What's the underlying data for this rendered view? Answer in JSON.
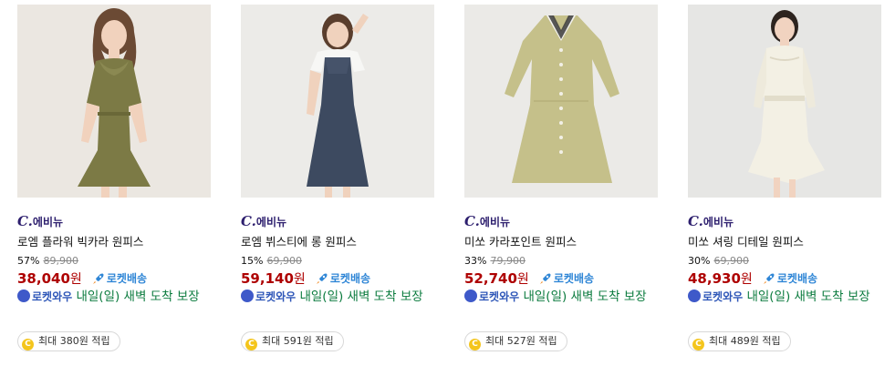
{
  "products": [
    {
      "brand_mark": "C.",
      "brand": "에비뉴",
      "name": "로엠 플라워 빅카라 원피스",
      "discount": "57%",
      "original_price": "89,900",
      "price": "38,040",
      "won": "원",
      "rocket_label": "로켓배송",
      "wow_label": "로켓와우",
      "delivery": "내일(일) 새벽 도착 보장",
      "reward": "최대 380원 적립",
      "coin_symbol": "C",
      "image_desc": "dress-floral-olive"
    },
    {
      "brand_mark": "C.",
      "brand": "에비뉴",
      "name": "로엠 뷔스티에 롱 원피스",
      "discount": "15%",
      "original_price": "69,900",
      "price": "59,140",
      "won": "원",
      "rocket_label": "로켓배송",
      "wow_label": "로켓와우",
      "delivery": "내일(일) 새벽 도착 보장",
      "reward": "최대 591원 적립",
      "coin_symbol": "C",
      "image_desc": "dress-navy-bustier"
    },
    {
      "brand_mark": "C.",
      "brand": "에비뉴",
      "name": "미쏘 카라포인트 원피스",
      "discount": "33%",
      "original_price": "79,900",
      "price": "52,740",
      "won": "원",
      "rocket_label": "로켓배송",
      "wow_label": "로켓와우",
      "delivery": "내일(일) 새벽 도착 보장",
      "reward": "최대 527원 적립",
      "coin_symbol": "C",
      "image_desc": "dress-khaki-collar"
    },
    {
      "brand_mark": "C.",
      "brand": "에비뉴",
      "name": "미쏘 셔링 디테일 원피스",
      "discount": "30%",
      "original_price": "69,900",
      "price": "48,930",
      "won": "원",
      "rocket_label": "로켓배송",
      "wow_label": "로켓와우",
      "delivery": "내일(일) 새벽 도착 보장",
      "reward": "최대 489원 적립",
      "coin_symbol": "C",
      "image_desc": "dress-ivory-shirring"
    }
  ],
  "colors": {
    "price": "#ae0000",
    "rocket": "#2f86d6",
    "delivery": "#0b7b3e",
    "brand": "#2d1f6e",
    "coin": "#f4c51c"
  }
}
